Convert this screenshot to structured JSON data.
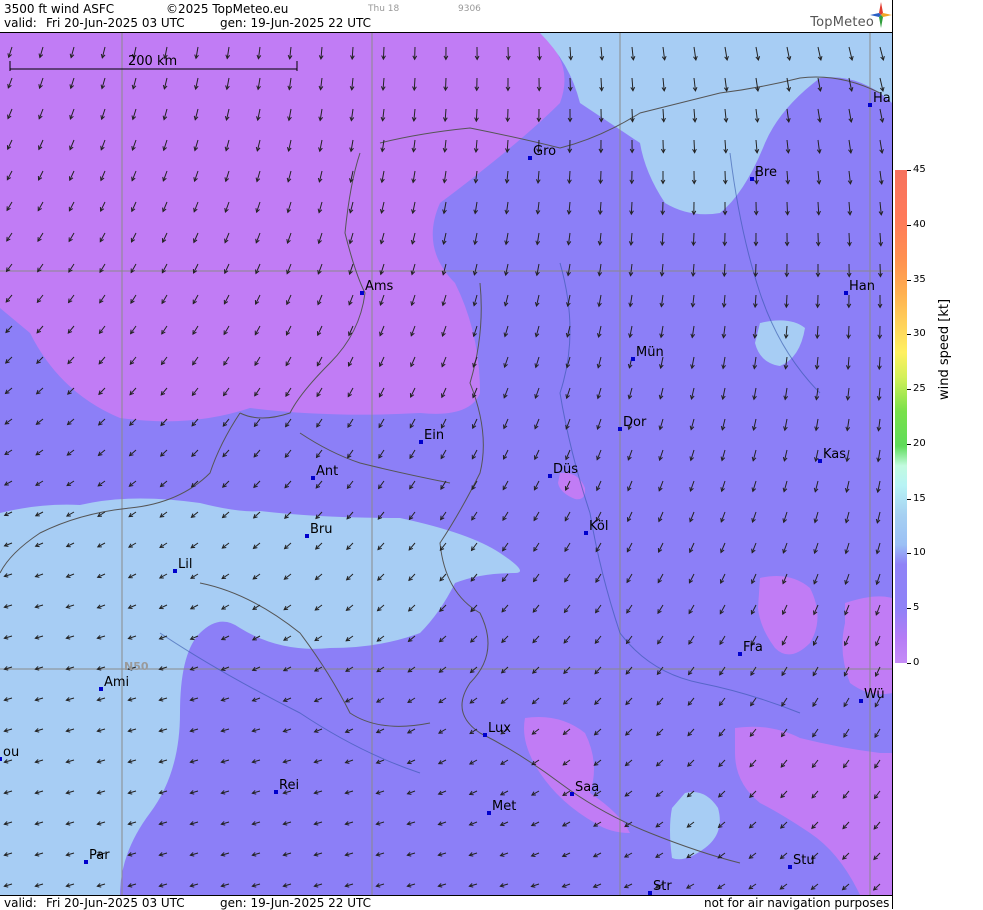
{
  "header": {
    "product": "3500 ft wind ASFC",
    "copyright": "©2025 TopMeteo.eu",
    "aux_day": "Thu 18",
    "aux_code": "9306",
    "valid_label": "valid:",
    "valid_time": "Fri  20-Jun-2025  03 UTC",
    "gen_time": "gen: 19-Jun-2025 22 UTC",
    "brand": "TopMeteo"
  },
  "footer": {
    "valid_label": "valid:",
    "valid_time": "Fri  20-Jun-2025  03 UTC",
    "gen_time": "gen: 19-Jun-2025 22 UTC",
    "disclaimer": "not for air navigation purposes"
  },
  "map": {
    "scale_label": "200 km",
    "lat_label": "N50",
    "cities": [
      {
        "label": "Gro"
      },
      {
        "label": "Bre"
      },
      {
        "label": "Ha"
      },
      {
        "label": "Ams"
      },
      {
        "label": "Han"
      },
      {
        "label": "Mün"
      },
      {
        "label": "Ein"
      },
      {
        "label": "Dor"
      },
      {
        "label": "Ant"
      },
      {
        "label": "Düs"
      },
      {
        "label": "Kas"
      },
      {
        "label": "Bru"
      },
      {
        "label": "Köl"
      },
      {
        "label": "Lil"
      },
      {
        "label": "Fra"
      },
      {
        "label": "Ami"
      },
      {
        "label": "Wü"
      },
      {
        "label": "ou"
      },
      {
        "label": "Lux"
      },
      {
        "label": "Rei"
      },
      {
        "label": "Saa"
      },
      {
        "label": "Met"
      },
      {
        "label": "Par"
      },
      {
        "label": "Stu"
      },
      {
        "label": "Str"
      }
    ],
    "colors": {
      "calm": "#c17cf5",
      "light": "#8c7ff7",
      "moderate": "#a7cdf4",
      "arrow": "#222222",
      "city_marker": "#0000cc"
    }
  },
  "legend": {
    "title": "wind speed [kt]",
    "ticks": [
      "45",
      "40",
      "35",
      "30",
      "25",
      "20",
      "15",
      "10",
      "5",
      "0"
    ]
  }
}
